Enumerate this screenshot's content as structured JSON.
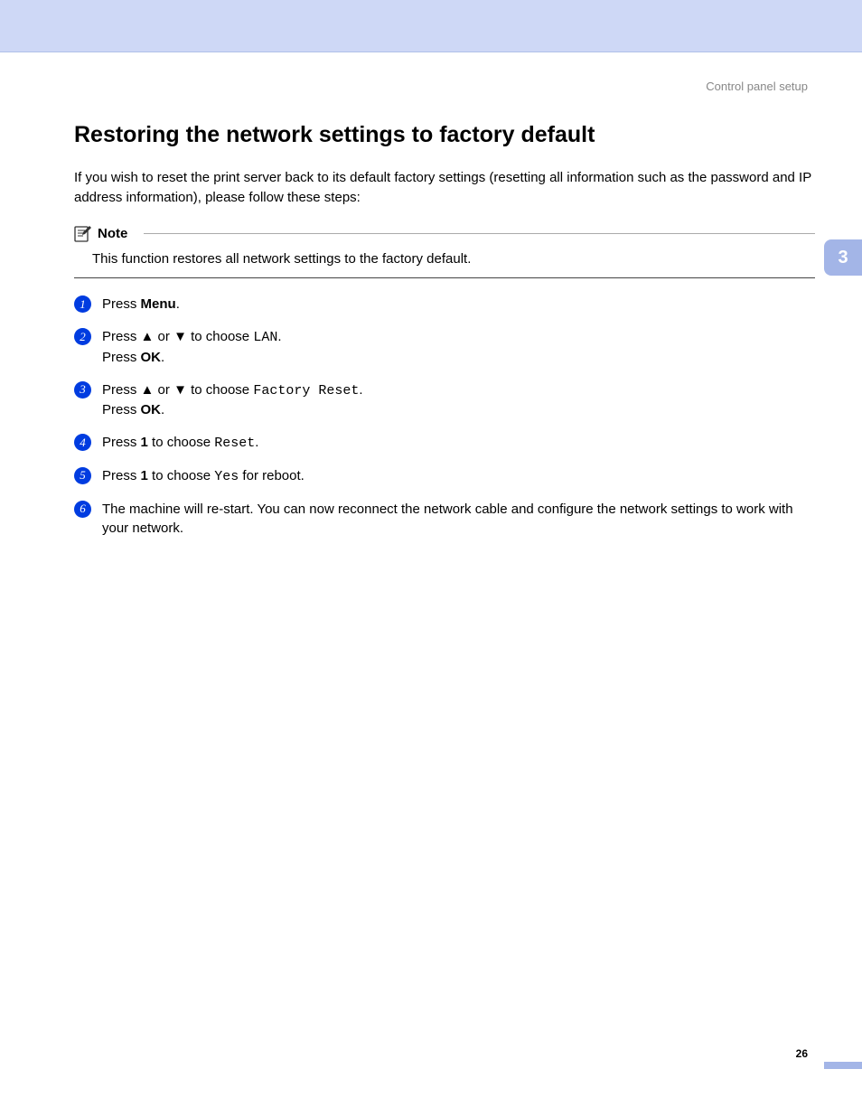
{
  "header": {
    "section_title": "Control panel setup"
  },
  "chapter_tab": "3",
  "title": "Restoring the network settings to factory default",
  "intro": "If you wish to reset the print server back to its default factory settings (resetting all information such as the password and IP address information), please follow these steps:",
  "note": {
    "label": "Note",
    "text": "This function restores all network settings to the factory default."
  },
  "steps": [
    {
      "num": "1",
      "parts": [
        {
          "t": "Press "
        },
        {
          "t": "Menu",
          "bold": true
        },
        {
          "t": "."
        }
      ]
    },
    {
      "num": "2",
      "parts": [
        {
          "t": "Press "
        },
        {
          "t": "▲",
          "cls": "arrow"
        },
        {
          "t": " or "
        },
        {
          "t": "▼",
          "cls": "arrow"
        },
        {
          "t": " to choose "
        },
        {
          "t": "LAN",
          "cls": "mono"
        },
        {
          "t": "."
        },
        {
          "br": true
        },
        {
          "t": "Press "
        },
        {
          "t": "OK",
          "bold": true
        },
        {
          "t": "."
        }
      ]
    },
    {
      "num": "3",
      "parts": [
        {
          "t": "Press "
        },
        {
          "t": "▲",
          "cls": "arrow"
        },
        {
          "t": " or "
        },
        {
          "t": "▼",
          "cls": "arrow"
        },
        {
          "t": " to choose "
        },
        {
          "t": "Factory Reset",
          "cls": "mono"
        },
        {
          "t": "."
        },
        {
          "br": true
        },
        {
          "t": "Press "
        },
        {
          "t": "OK",
          "bold": true
        },
        {
          "t": "."
        }
      ]
    },
    {
      "num": "4",
      "parts": [
        {
          "t": "Press "
        },
        {
          "t": "1",
          "bold": true
        },
        {
          "t": " to choose "
        },
        {
          "t": "Reset",
          "cls": "mono"
        },
        {
          "t": "."
        }
      ]
    },
    {
      "num": "5",
      "parts": [
        {
          "t": "Press "
        },
        {
          "t": "1",
          "bold": true
        },
        {
          "t": " to choose "
        },
        {
          "t": "Yes",
          "cls": "mono"
        },
        {
          "t": " for reboot."
        }
      ]
    },
    {
      "num": "6",
      "parts": [
        {
          "t": "The machine will re-start. You can now reconnect the network cable and configure the network settings to work with your network."
        }
      ]
    }
  ],
  "page_number": "26"
}
